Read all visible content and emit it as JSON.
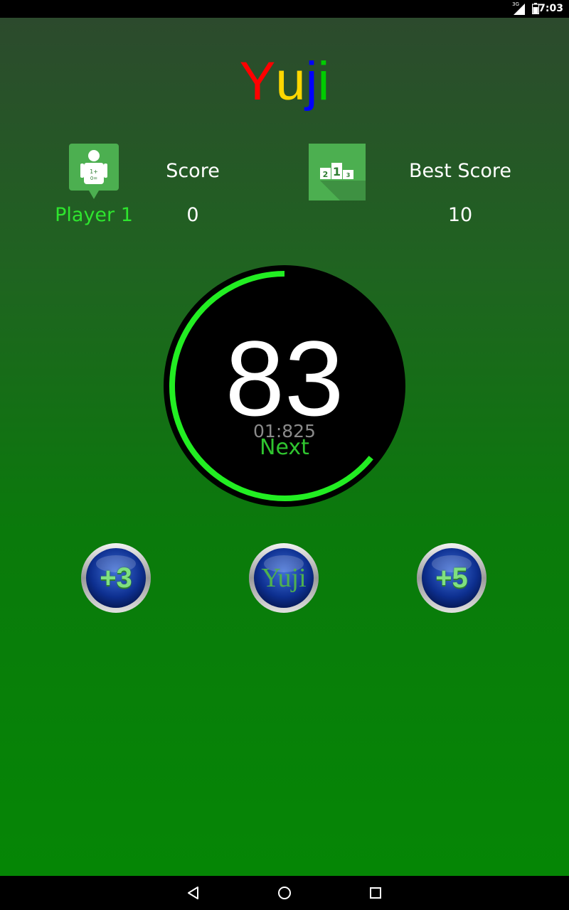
{
  "status_bar": {
    "network": "3G",
    "time": "7:03"
  },
  "app": {
    "title_letters": [
      {
        "char": "Y",
        "color": "#ff0000"
      },
      {
        "char": "u",
        "color": "#ffd700"
      },
      {
        "char": "j",
        "color": "#0000ff"
      },
      {
        "char": "i",
        "color": "#00cc00"
      }
    ],
    "player_name": "Player 1",
    "score_label": "Score",
    "score_value": "0",
    "best_label": "Best Score",
    "best_value": "10",
    "podium_digits": [
      "2",
      "1",
      "3"
    ],
    "player_icon_text": [
      "1+",
      "0="
    ]
  },
  "dial": {
    "number": "83",
    "timer": "01:825",
    "next_label": "Next",
    "progress_fraction": 0.64,
    "ring_color": "#22ee22"
  },
  "buttons": [
    {
      "label": "+3"
    },
    {
      "label": "Yuji"
    },
    {
      "label": "+5"
    }
  ]
}
